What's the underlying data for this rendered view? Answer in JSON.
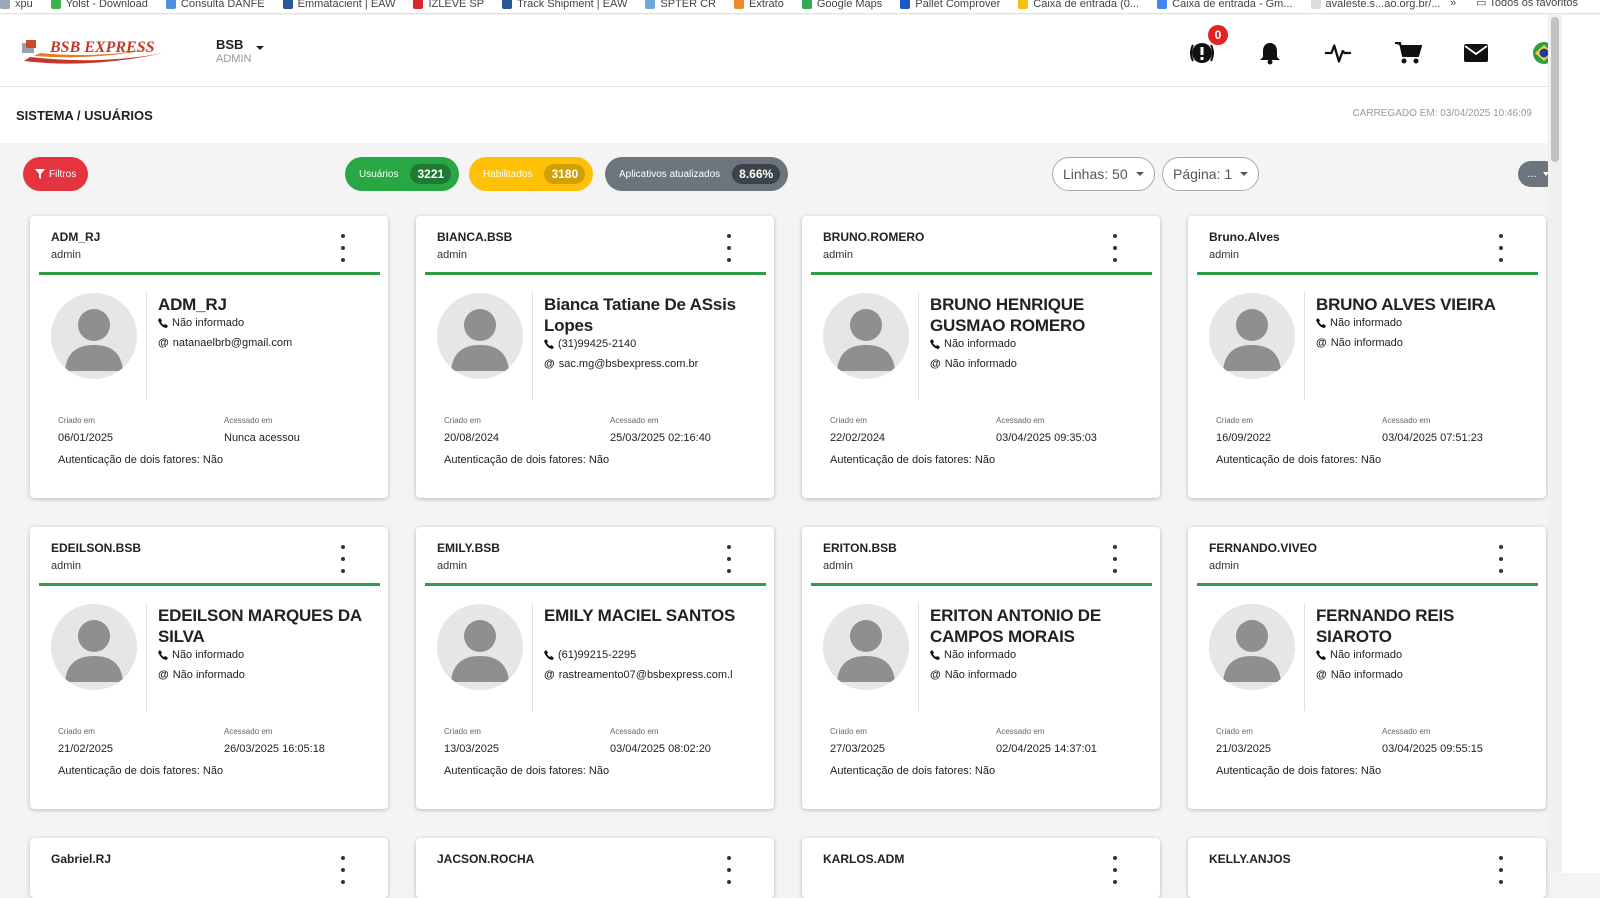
{
  "bookmarks": [
    "xpu",
    "Yolst - Download",
    "Consulta DANFE",
    "Emmatacient | EAW",
    "IZLEVE SP",
    "Track Shipment | EAW",
    "SPTER CR",
    "Extrato",
    "Google Maps",
    "Pallet Comprover",
    "Caixa de entrada (0...",
    "Caixa de entrada - Gm...",
    "avaleste.s...ao.org.br/..."
  ],
  "bookmarks_right": {
    "more": "»",
    "all": "Todos os favoritos"
  },
  "header": {
    "tenant_name": "BSB",
    "tenant_role": "ADMIN",
    "logo_text": "BSB EXPRESS",
    "alert_count": "0"
  },
  "page": {
    "breadcrumb": "SISTEMA / USUÁRIOS",
    "loaded_at": "CARREGADO EM: 03/04/2025 10:46:09"
  },
  "toolbar": {
    "filter_label": "Filtros",
    "users_label": "Usuários",
    "users_count": "3221",
    "enabled_label": "Habilitados",
    "enabled_count": "3180",
    "apps_label": "Aplicativos atualizados",
    "apps_pct": "8.66%",
    "lines_label": "Linhas: 50",
    "page_label": "Página: 1",
    "more_label": "..."
  },
  "labels": {
    "created": "Criado em",
    "accessed": "Acessado em"
  },
  "colors": {
    "accent_green": "#2e9e44",
    "filter_red": "#e3343f",
    "users_green": "#28a745",
    "enabled_yellow": "#ffc107",
    "apps_gray": "#6c757d"
  },
  "cards": [
    {
      "login": "ADM_RJ",
      "role": "admin",
      "name": "ADM_RJ",
      "phone": "Não informado",
      "email": "natanaelbrb@gmail.com",
      "created": "06/01/2025",
      "accessed": "Nunca acessou",
      "twofa": "Autenticação de dois fatores: Não"
    },
    {
      "login": "BIANCA.BSB",
      "role": "admin",
      "name": "Bianca Tatiane De ASsis Lopes",
      "phone": "(31)99425-2140",
      "email": "sac.mg@bsbexpress.com.br",
      "created": "20/08/2024",
      "accessed": "25/03/2025 02:16:40",
      "twofa": "Autenticação de dois fatores: Não"
    },
    {
      "login": "BRUNO.ROMERO",
      "role": "admin",
      "name": "BRUNO HENRIQUE GUSMAO ROMERO",
      "phone": "Não informado",
      "email": "Não informado",
      "created": "22/02/2024",
      "accessed": "03/04/2025 09:35:03",
      "twofa": "Autenticação de dois fatores: Não"
    },
    {
      "login": "Bruno.Alves",
      "role": "admin",
      "name": "BRUNO ALVES VIEIRA",
      "phone": "Não informado",
      "email": "Não informado",
      "created": "16/09/2022",
      "accessed": "03/04/2025 07:51:23",
      "twofa": "Autenticação de dois fatores: Não"
    },
    {
      "login": "EDEILSON.BSB",
      "role": "admin",
      "name": "EDEILSON MARQUES DA SILVA",
      "phone": "Não informado",
      "email": "Não informado",
      "created": "21/02/2025",
      "accessed": "26/03/2025 16:05:18",
      "twofa": "Autenticação de dois fatores: Não"
    },
    {
      "login": "EMILY.BSB",
      "role": "admin",
      "name": "EMILY MACIEL SANTOS",
      "phone": "(61)99215-2295",
      "email": "rastreamento07@bsbexpress.com.l",
      "created": "13/03/2025",
      "accessed": "03/04/2025 08:02:20",
      "twofa": "Autenticação de dois fatores: Não"
    },
    {
      "login": "ERITON.BSB",
      "role": "admin",
      "name": "ERITON ANTONIO DE CAMPOS MORAIS",
      "phone": "Não informado",
      "email": "Não informado",
      "created": "27/03/2025",
      "accessed": "02/04/2025 14:37:01",
      "twofa": "Autenticação de dois fatores: Não"
    },
    {
      "login": "FERNANDO.VIVEO",
      "role": "admin",
      "name": "FERNANDO REIS SIAROTO",
      "phone": "Não informado",
      "email": "Não informado",
      "created": "21/03/2025",
      "accessed": "03/04/2025 09:55:15",
      "twofa": "Autenticação de dois fatores: Não"
    },
    {
      "login": "Gabriel.RJ"
    },
    {
      "login": "JACSON.ROCHA"
    },
    {
      "login": "KARLOS.ADM"
    },
    {
      "login": "KELLY.ANJOS"
    }
  ]
}
